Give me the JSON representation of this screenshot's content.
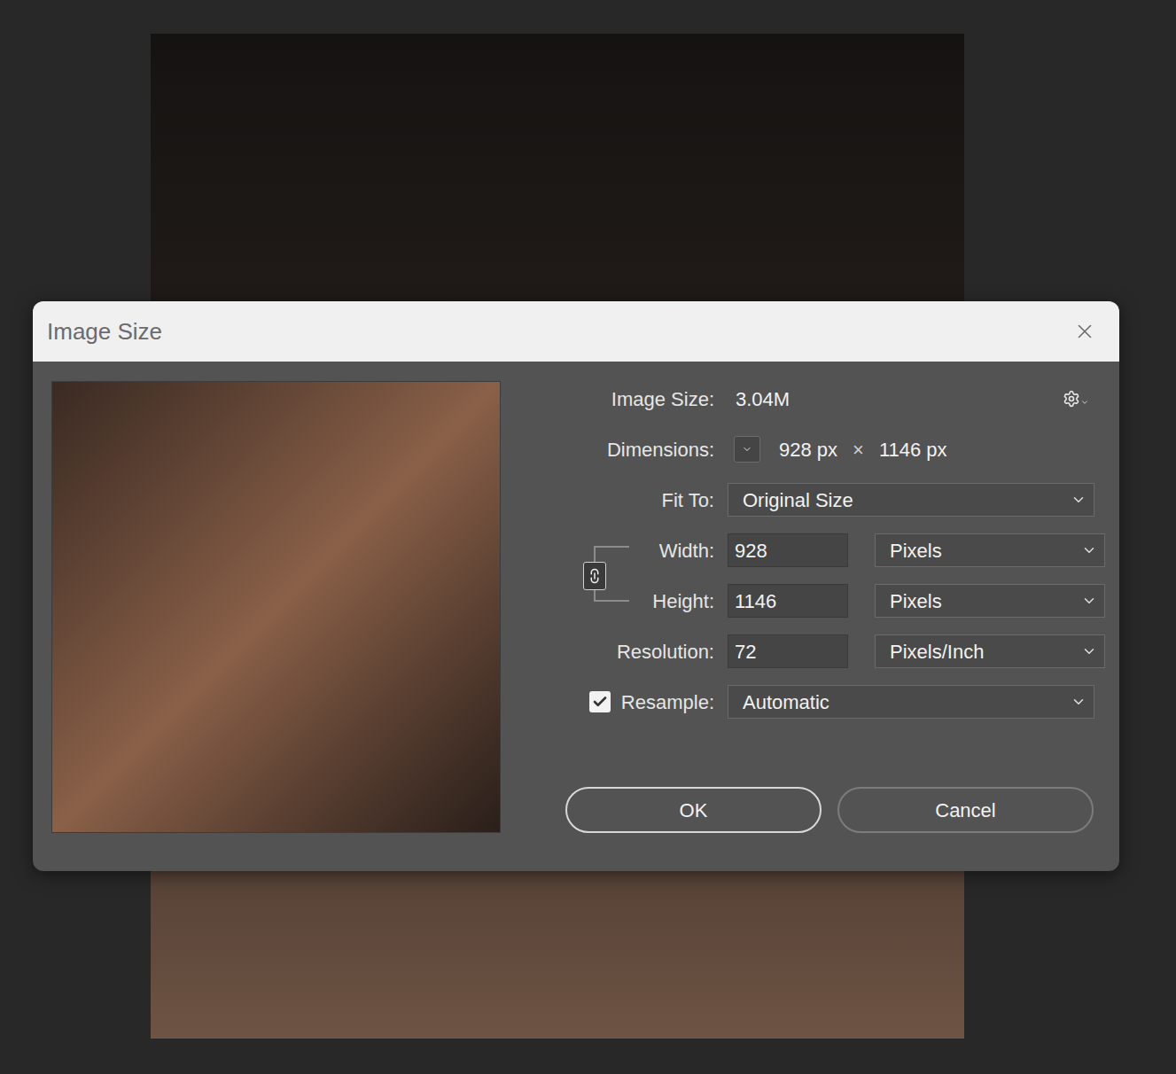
{
  "window": {
    "title": "Image Size"
  },
  "image_size": {
    "label": "Image Size:",
    "value": "3.04M"
  },
  "dimensions": {
    "label": "Dimensions:",
    "width": "928 px",
    "separator": "×",
    "height": "1146 px"
  },
  "fit_to": {
    "label": "Fit To:",
    "value": "Original Size"
  },
  "width": {
    "label": "Width:",
    "value": "928",
    "unit": "Pixels"
  },
  "height": {
    "label": "Height:",
    "value": "1146",
    "unit": "Pixels"
  },
  "resolution": {
    "label": "Resolution:",
    "value": "72",
    "unit": "Pixels/Inch"
  },
  "constrain": {
    "linked": true
  },
  "resample": {
    "label": "Resample:",
    "checked": true,
    "value": "Automatic"
  },
  "buttons": [
    {
      "label": "OK",
      "default": true
    },
    {
      "label": "Cancel",
      "default": false
    }
  ]
}
